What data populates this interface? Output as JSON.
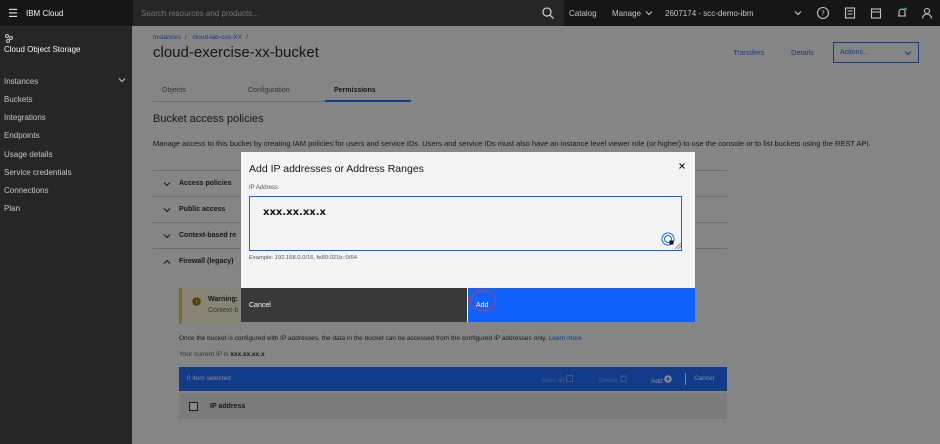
{
  "topbar": {
    "brand": "IBM Cloud",
    "search_placeholder": "Search resources and products...",
    "catalog": "Catalog",
    "manage": "Manage",
    "account": "2607174 - scc-demo-ibm"
  },
  "leftnav": {
    "service": "Cloud Object Storage",
    "items": [
      "Instances",
      "Buckets",
      "Integrations",
      "Endpoints",
      "Usage details",
      "Service credentials",
      "Connections",
      "Plan"
    ]
  },
  "header": {
    "breadcrumb": [
      "Instances",
      "cloud-lab-cos-XX"
    ],
    "title": "cloud-exercise-xx-bucket",
    "transfers": "Transfers",
    "details": "Details",
    "actions": "Actions..."
  },
  "tabs": [
    "Objects",
    "Configuration",
    "Permissions"
  ],
  "active_tab": "Permissions",
  "section": {
    "title": "Bucket access policies",
    "description": "Manage access to this bucket by creating IAM policies for users and service IDs. Users and service IDs must also have an instance level viewer role (or higher) to use the console or to list buckets using the REST API."
  },
  "accordion": [
    "Access policies",
    "Public access",
    "Context-based re",
    "Firewall (legacy)"
  ],
  "warning": {
    "title": "Warning:",
    "body": "Context-b"
  },
  "firewall": {
    "note": "Once the bucket is configured with IP addresses, the data in the bucket can be accessed from the configured IP addresses only.",
    "learn_more": "Learn more",
    "current_ip_label": "Your current IP is",
    "current_ip": "xxx.xx.xx.x"
  },
  "batch": {
    "selected": "0 item selected",
    "save_all": "Save all",
    "delete": "Delete",
    "add": "Add",
    "cancel": "Cancel"
  },
  "table": {
    "header": "IP address"
  },
  "modal": {
    "title": "Add IP addresses or Address Ranges",
    "field_label": "IP Address",
    "field_value": "xxx.xx.xx.x",
    "helper": "Example: 192.168.0.0/16, fe80:021b::0/64",
    "cancel": "Cancel",
    "add": "Add"
  },
  "colors": {
    "primary": "#0f62fe",
    "highlight_ring": "#e3303a",
    "warning": "#f1c21b"
  }
}
